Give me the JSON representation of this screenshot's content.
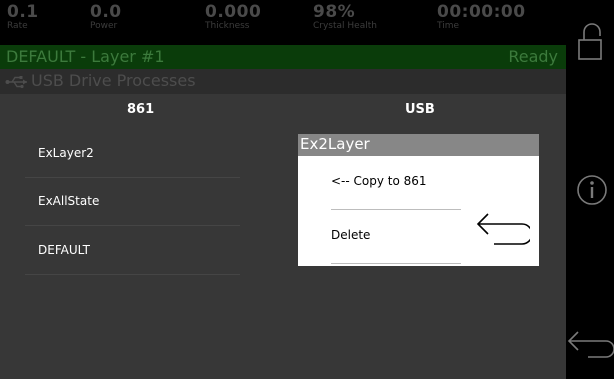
{
  "status": {
    "rate": {
      "value": "0.1",
      "label": "Rate"
    },
    "power": {
      "value": "0.0",
      "label": "Power"
    },
    "thickness": {
      "value": "0.000",
      "label": "Thickness"
    },
    "crystal": {
      "value": "98%",
      "label": "Crystal Health"
    },
    "time": {
      "value": "00:00:00",
      "label": "Time"
    }
  },
  "layer": {
    "name": "DEFAULT - Layer #1",
    "state": "Ready"
  },
  "title": "USB Drive Processes",
  "columns": {
    "left": "861",
    "right": "USB"
  },
  "processes": [
    "ExLayer2",
    "ExAllState",
    "DEFAULT"
  ],
  "popup": {
    "title": "Ex2Layer",
    "items": [
      "<-- Copy to 861",
      "Delete"
    ]
  },
  "sidebar": {
    "icons": [
      "lock-icon",
      "info-icon",
      "back-arrow-icon"
    ]
  },
  "colors": {
    "content_bg": "#373737",
    "layer_bar_bg": "#0a3c0a",
    "popup_header": "#878787"
  }
}
